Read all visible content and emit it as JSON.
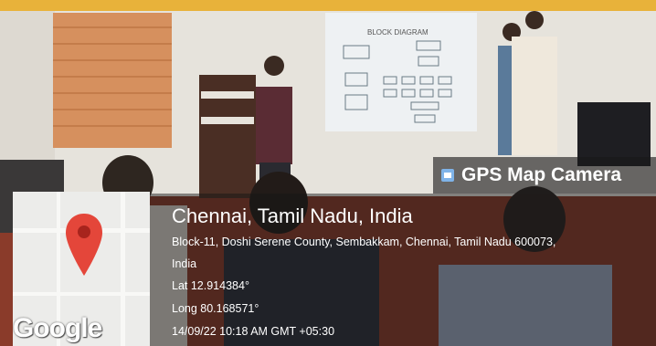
{
  "overlay": {
    "camera_label": "GPS Map Camera",
    "location_title": "Chennai, Tamil Nadu, India",
    "address_line1": "Block-11, Doshi Serene County, Sembakkam, Chennai, Tamil Nadu 600073,",
    "address_line2": "India",
    "latitude": "Lat 12.914384°",
    "longitude": "Long 80.168571°",
    "timestamp": "14/09/22 10:18 AM GMT +05:30",
    "map_brand": "Google"
  },
  "slide": {
    "title": "BLOCK DIAGRAM"
  },
  "colors": {
    "pin": "#e4463a",
    "overlay_bg": "#141414",
    "wall": "#e9e6df"
  }
}
